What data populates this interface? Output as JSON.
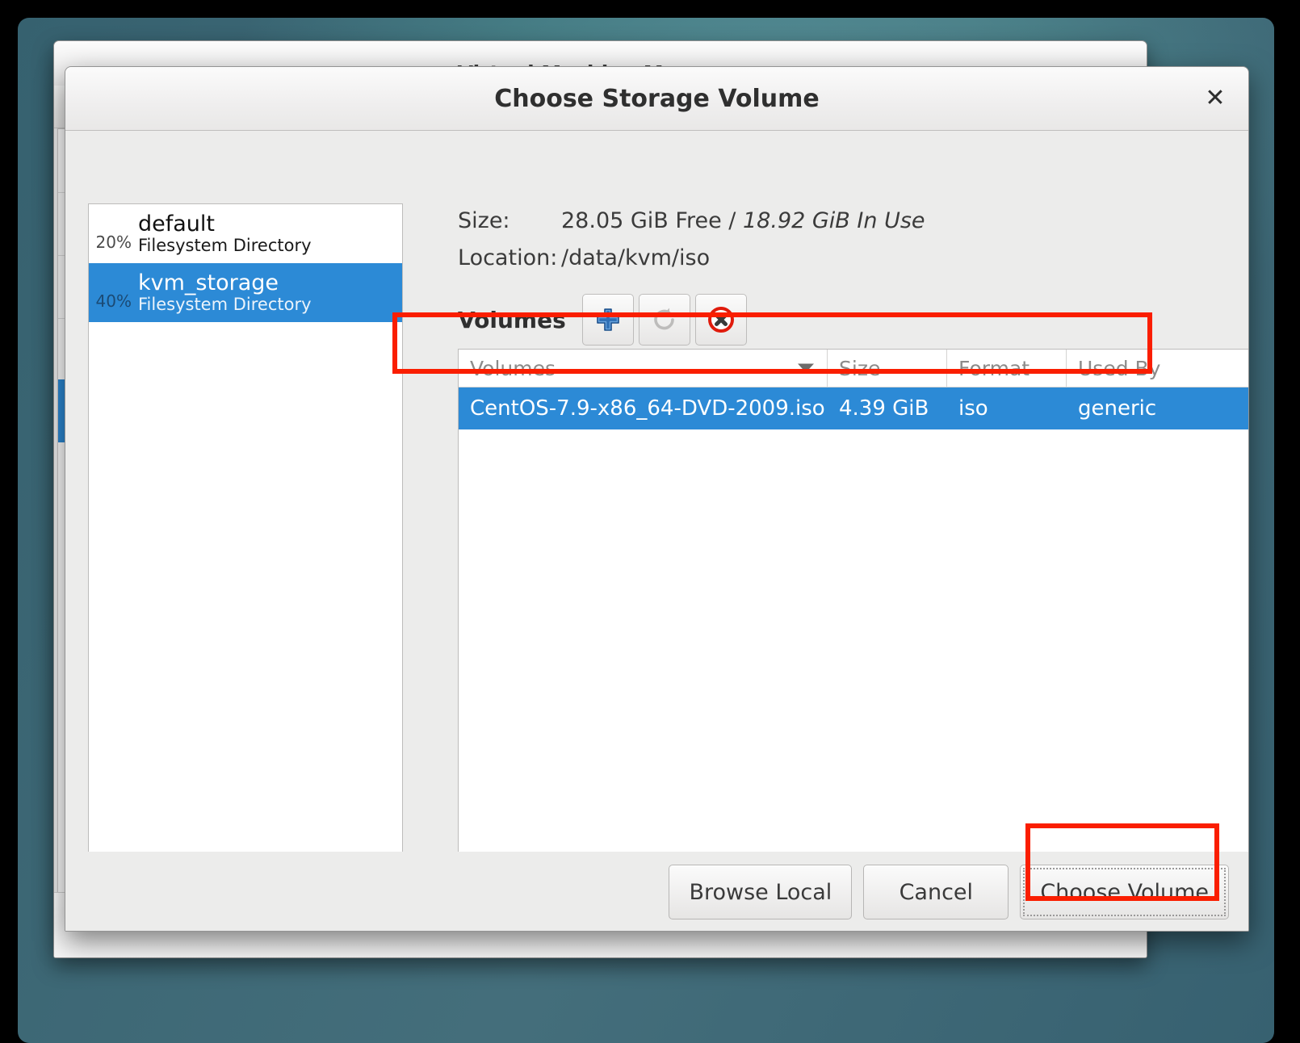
{
  "background_window": {
    "title": "Virtual Machine Manager"
  },
  "dialog": {
    "title": "Choose Storage Volume",
    "close_icon": "close-icon",
    "close_glyph": "✕",
    "pools": [
      {
        "percent": "20%",
        "name": "default",
        "type": "Filesystem Directory",
        "selected": false
      },
      {
        "percent": "40%",
        "name": "kvm_storage",
        "type": "Filesystem Directory",
        "selected": true
      }
    ],
    "pool_toolbar": [
      {
        "name": "add-pool-button",
        "icon": "plus-icon",
        "enabled": true
      },
      {
        "name": "start-pool-button",
        "icon": "play-icon",
        "enabled": false
      },
      {
        "name": "stop-pool-button",
        "icon": "stop-icon",
        "enabled": true
      },
      {
        "name": "delete-pool-button",
        "icon": "delete-circle-icon",
        "enabled": false
      }
    ],
    "info": {
      "size_label": "Size:",
      "size_free": "28.05 GiB Free",
      "size_sep": "/",
      "size_inuse": "18.92 GiB In Use",
      "location_label": "Location:",
      "location_value": "/data/kvm/iso"
    },
    "volumes": {
      "section_label": "Volumes",
      "toolbar": [
        {
          "name": "add-volume-button",
          "icon": "plus-icon",
          "enabled": true
        },
        {
          "name": "refresh-volumes-button",
          "icon": "refresh-icon",
          "enabled": true
        },
        {
          "name": "delete-volume-button",
          "icon": "delete-circle-icon",
          "enabled": true
        }
      ],
      "columns": [
        {
          "label": "Volumes",
          "sorted": true
        },
        {
          "label": "Size",
          "sorted": false
        },
        {
          "label": "Format",
          "sorted": false
        },
        {
          "label": "Used By",
          "sorted": false
        }
      ],
      "rows": [
        {
          "volume": "CentOS-7.9-x86_64-DVD-2009.iso",
          "size": "4.39 GiB",
          "format": "iso",
          "used_by": "generic",
          "selected": true
        }
      ]
    },
    "footer": {
      "browse_local": "Browse Local",
      "cancel": "Cancel",
      "choose_volume": "Choose Volume"
    }
  },
  "colors": {
    "selection_blue": "#2c8ad6",
    "annotation_red": "#fa1e00",
    "desktop_teal": "#3f7880",
    "dialog_bg": "#ececeb"
  }
}
